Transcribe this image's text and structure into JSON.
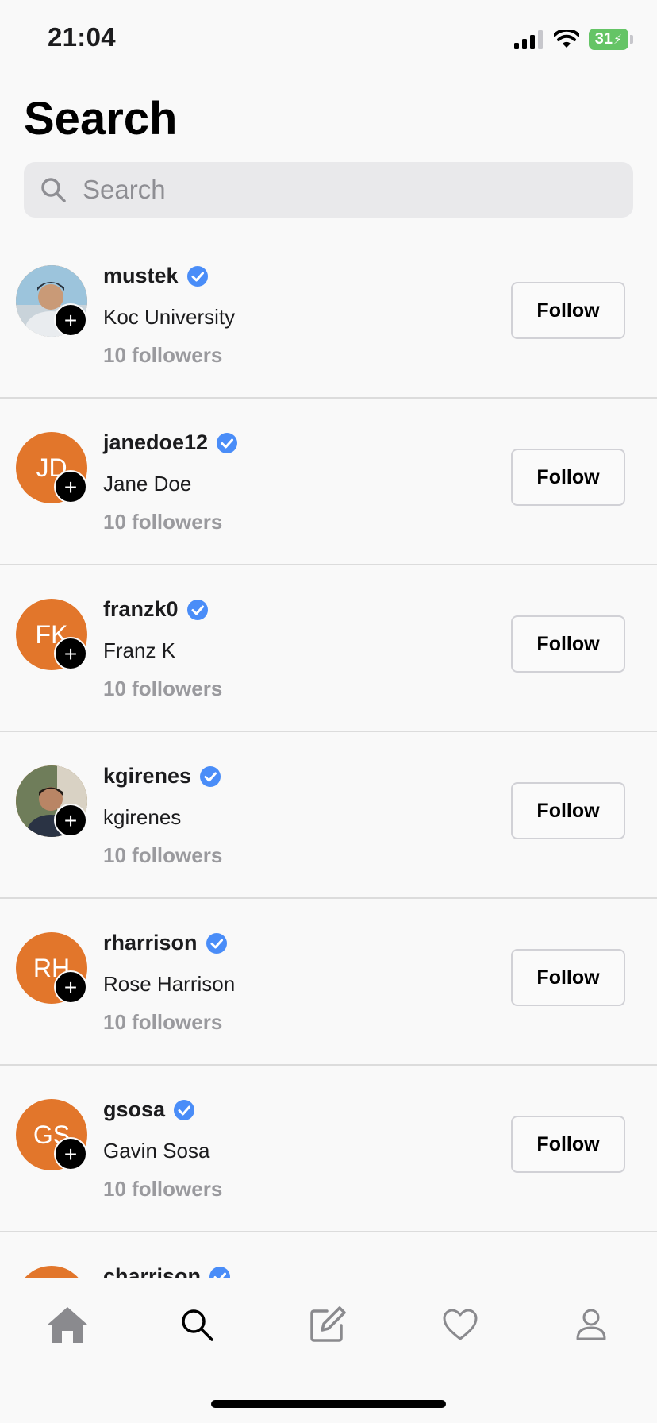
{
  "status_bar": {
    "time": "21:04",
    "battery": "31"
  },
  "header": {
    "title": "Search"
  },
  "search": {
    "placeholder": "Search"
  },
  "users": [
    {
      "username": "mustek",
      "name": "Koc University",
      "followers": "10 followers",
      "initials": "",
      "follow_label": "Follow"
    },
    {
      "username": "janedoe12",
      "name": "Jane Doe",
      "followers": "10 followers",
      "initials": "JD",
      "follow_label": "Follow"
    },
    {
      "username": "franzk0",
      "name": "Franz K",
      "followers": "10 followers",
      "initials": "FK",
      "follow_label": "Follow"
    },
    {
      "username": "kgirenes",
      "name": "kgirenes",
      "followers": "10 followers",
      "initials": "",
      "follow_label": "Follow"
    },
    {
      "username": "rharrison",
      "name": "Rose Harrison",
      "followers": "10 followers",
      "initials": "RH",
      "follow_label": "Follow"
    },
    {
      "username": "gsosa",
      "name": "Gavin Sosa",
      "followers": "10 followers",
      "initials": "GS",
      "follow_label": "Follow"
    },
    {
      "username": "charrison",
      "name": "",
      "followers": "",
      "initials": "",
      "follow_label": ""
    }
  ],
  "avatar_badge": "+",
  "tabs": [
    {
      "icon": "home-icon",
      "active": false
    },
    {
      "icon": "search-icon",
      "active": true
    },
    {
      "icon": "compose-icon",
      "active": false
    },
    {
      "icon": "heart-icon",
      "active": false
    },
    {
      "icon": "profile-icon",
      "active": false
    }
  ],
  "colors": {
    "accent_verified": "#4a8df8",
    "avatar_orange": "#e2762b",
    "battery_green": "#65c466"
  }
}
